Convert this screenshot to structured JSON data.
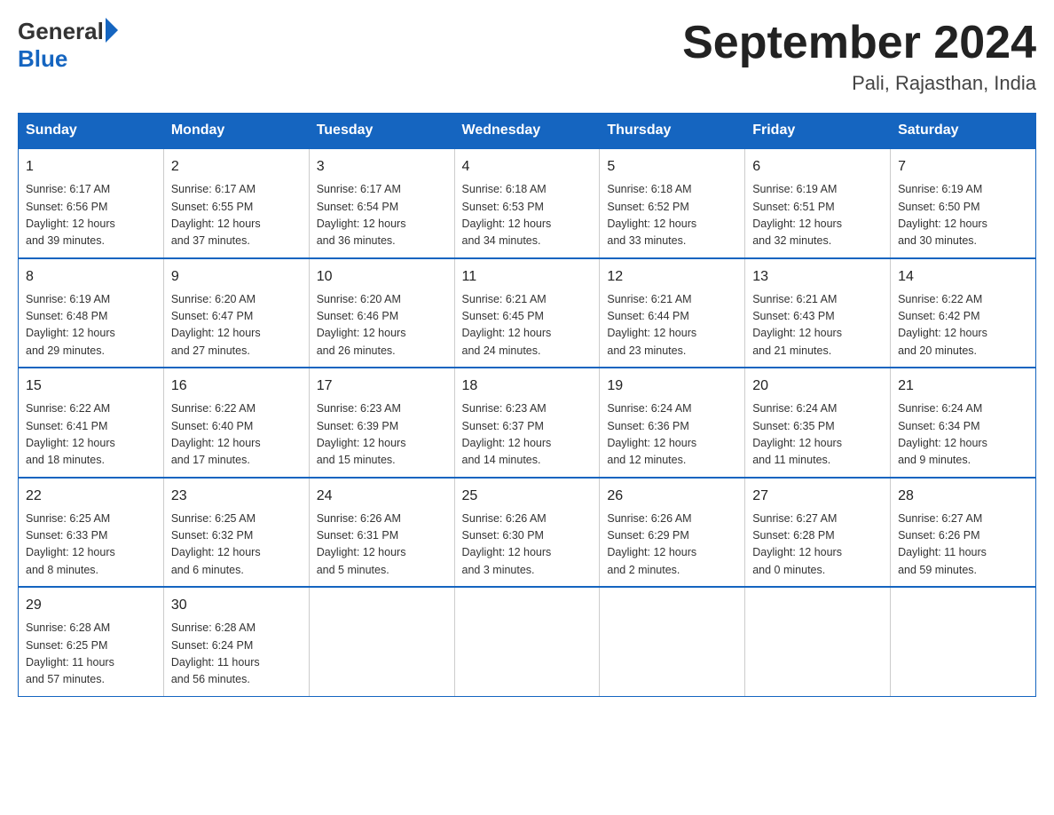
{
  "header": {
    "logo_general": "General",
    "logo_blue": "Blue",
    "title": "September 2024",
    "location": "Pali, Rajasthan, India"
  },
  "days_of_week": [
    "Sunday",
    "Monday",
    "Tuesday",
    "Wednesday",
    "Thursday",
    "Friday",
    "Saturday"
  ],
  "weeks": [
    [
      {
        "day": 1,
        "sunrise": "6:17 AM",
        "sunset": "6:56 PM",
        "daylight": "12 hours and 39 minutes."
      },
      {
        "day": 2,
        "sunrise": "6:17 AM",
        "sunset": "6:55 PM",
        "daylight": "12 hours and 37 minutes."
      },
      {
        "day": 3,
        "sunrise": "6:17 AM",
        "sunset": "6:54 PM",
        "daylight": "12 hours and 36 minutes."
      },
      {
        "day": 4,
        "sunrise": "6:18 AM",
        "sunset": "6:53 PM",
        "daylight": "12 hours and 34 minutes."
      },
      {
        "day": 5,
        "sunrise": "6:18 AM",
        "sunset": "6:52 PM",
        "daylight": "12 hours and 33 minutes."
      },
      {
        "day": 6,
        "sunrise": "6:19 AM",
        "sunset": "6:51 PM",
        "daylight": "12 hours and 32 minutes."
      },
      {
        "day": 7,
        "sunrise": "6:19 AM",
        "sunset": "6:50 PM",
        "daylight": "12 hours and 30 minutes."
      }
    ],
    [
      {
        "day": 8,
        "sunrise": "6:19 AM",
        "sunset": "6:48 PM",
        "daylight": "12 hours and 29 minutes."
      },
      {
        "day": 9,
        "sunrise": "6:20 AM",
        "sunset": "6:47 PM",
        "daylight": "12 hours and 27 minutes."
      },
      {
        "day": 10,
        "sunrise": "6:20 AM",
        "sunset": "6:46 PM",
        "daylight": "12 hours and 26 minutes."
      },
      {
        "day": 11,
        "sunrise": "6:21 AM",
        "sunset": "6:45 PM",
        "daylight": "12 hours and 24 minutes."
      },
      {
        "day": 12,
        "sunrise": "6:21 AM",
        "sunset": "6:44 PM",
        "daylight": "12 hours and 23 minutes."
      },
      {
        "day": 13,
        "sunrise": "6:21 AM",
        "sunset": "6:43 PM",
        "daylight": "12 hours and 21 minutes."
      },
      {
        "day": 14,
        "sunrise": "6:22 AM",
        "sunset": "6:42 PM",
        "daylight": "12 hours and 20 minutes."
      }
    ],
    [
      {
        "day": 15,
        "sunrise": "6:22 AM",
        "sunset": "6:41 PM",
        "daylight": "12 hours and 18 minutes."
      },
      {
        "day": 16,
        "sunrise": "6:22 AM",
        "sunset": "6:40 PM",
        "daylight": "12 hours and 17 minutes."
      },
      {
        "day": 17,
        "sunrise": "6:23 AM",
        "sunset": "6:39 PM",
        "daylight": "12 hours and 15 minutes."
      },
      {
        "day": 18,
        "sunrise": "6:23 AM",
        "sunset": "6:37 PM",
        "daylight": "12 hours and 14 minutes."
      },
      {
        "day": 19,
        "sunrise": "6:24 AM",
        "sunset": "6:36 PM",
        "daylight": "12 hours and 12 minutes."
      },
      {
        "day": 20,
        "sunrise": "6:24 AM",
        "sunset": "6:35 PM",
        "daylight": "12 hours and 11 minutes."
      },
      {
        "day": 21,
        "sunrise": "6:24 AM",
        "sunset": "6:34 PM",
        "daylight": "12 hours and 9 minutes."
      }
    ],
    [
      {
        "day": 22,
        "sunrise": "6:25 AM",
        "sunset": "6:33 PM",
        "daylight": "12 hours and 8 minutes."
      },
      {
        "day": 23,
        "sunrise": "6:25 AM",
        "sunset": "6:32 PM",
        "daylight": "12 hours and 6 minutes."
      },
      {
        "day": 24,
        "sunrise": "6:26 AM",
        "sunset": "6:31 PM",
        "daylight": "12 hours and 5 minutes."
      },
      {
        "day": 25,
        "sunrise": "6:26 AM",
        "sunset": "6:30 PM",
        "daylight": "12 hours and 3 minutes."
      },
      {
        "day": 26,
        "sunrise": "6:26 AM",
        "sunset": "6:29 PM",
        "daylight": "12 hours and 2 minutes."
      },
      {
        "day": 27,
        "sunrise": "6:27 AM",
        "sunset": "6:28 PM",
        "daylight": "12 hours and 0 minutes."
      },
      {
        "day": 28,
        "sunrise": "6:27 AM",
        "sunset": "6:26 PM",
        "daylight": "11 hours and 59 minutes."
      }
    ],
    [
      {
        "day": 29,
        "sunrise": "6:28 AM",
        "sunset": "6:25 PM",
        "daylight": "11 hours and 57 minutes."
      },
      {
        "day": 30,
        "sunrise": "6:28 AM",
        "sunset": "6:24 PM",
        "daylight": "11 hours and 56 minutes."
      },
      null,
      null,
      null,
      null,
      null
    ]
  ],
  "labels": {
    "sunrise": "Sunrise:",
    "sunset": "Sunset:",
    "daylight": "Daylight:"
  }
}
